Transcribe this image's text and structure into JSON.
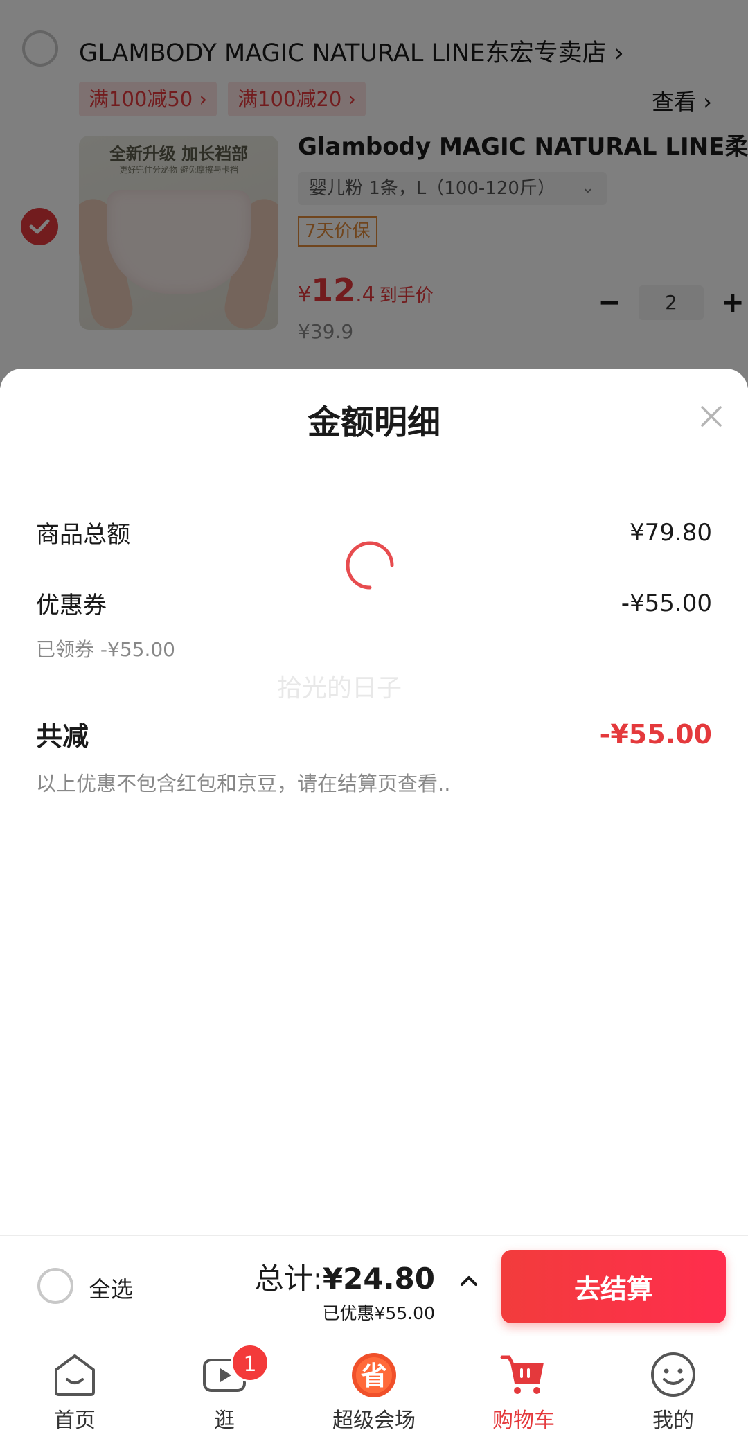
{
  "shop": {
    "name": "GLAMBODY MAGIC NATURAL LINE东宏专卖店 ›",
    "coupons": [
      "满100减50 ›",
      "满100减20 ›"
    ],
    "view_label": "查看 ›"
  },
  "product": {
    "image_banner_main": "全新升级 加长裆部",
    "image_banner_sub": "更好兜住分泌物 避免摩擦与卡裆",
    "title": "Glambody MAGIC NATURAL LINE柔",
    "spec": "婴儿粉 1条，L（100-120斤）",
    "price_guarantee": "7天价保",
    "price_currency": "¥",
    "price_int": "12",
    "price_dec": ".4",
    "price_label": "到手价",
    "original_price": "¥39.9",
    "quantity": "2",
    "minus_glyph": "−",
    "plus_glyph": "+"
  },
  "sheet": {
    "title": "金额明细",
    "goods_total_label": "商品总额",
    "goods_total_value": "¥79.80",
    "coupon_label": "优惠券",
    "coupon_value": "-¥55.00",
    "coupon_note": "已领券 -¥55.00",
    "watermark": "拾光的日子",
    "total_discount_label": "共减",
    "total_discount_value": "-¥55.00",
    "disclaimer": "以上优惠不包含红包和京豆，请在结算页查看.."
  },
  "checkout": {
    "select_all": "全选",
    "total_prefix": "总计:",
    "total_amount": "¥24.80",
    "saved": "已优惠¥55.00",
    "pay_button": "去结算"
  },
  "tabs": [
    {
      "label": "首页",
      "icon": "home-icon"
    },
    {
      "label": "逛",
      "icon": "video-icon",
      "badge": "1"
    },
    {
      "label": "超级会场",
      "icon": "super-venue-icon"
    },
    {
      "label": "购物车",
      "icon": "cart-icon",
      "active": true
    },
    {
      "label": "我的",
      "icon": "profile-icon"
    }
  ],
  "colors": {
    "accent": "#e4393c",
    "pay_gradient_start": "#f23c3c",
    "pay_gradient_end": "#ff2d4d",
    "guarantee": "#e08a3a"
  }
}
